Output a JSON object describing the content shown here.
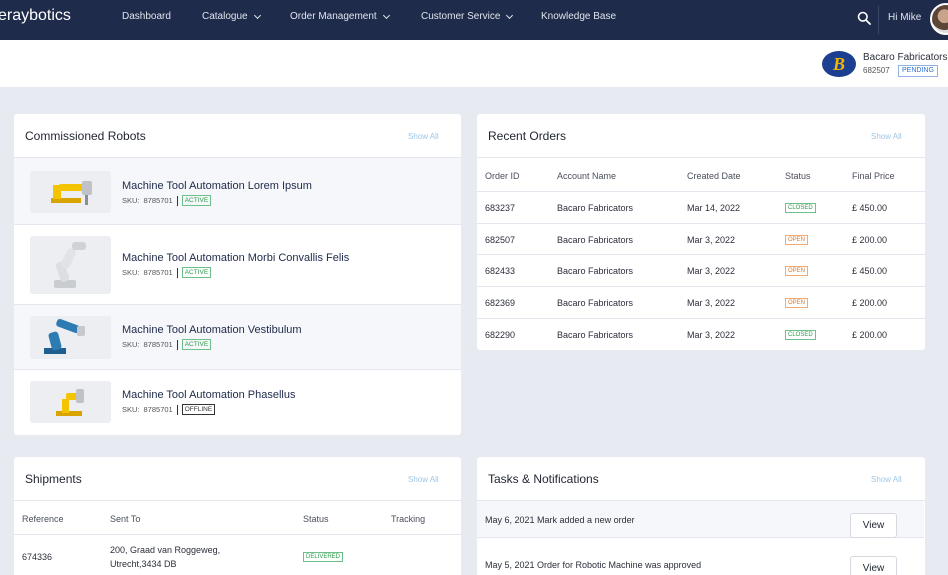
{
  "nav": {
    "brand": "eraybotics",
    "items": [
      {
        "label": "Dashboard"
      },
      {
        "label": "Catalogue"
      },
      {
        "label": "Order Management"
      },
      {
        "label": "Customer Service"
      },
      {
        "label": "Knowledge Base"
      }
    ],
    "greeting": "Hi Mike"
  },
  "company": {
    "logo_letter": "B",
    "name": "Bacaro Fabricators",
    "id": "682507",
    "status": "PENDING"
  },
  "robots": {
    "title": "Commissioned Robots",
    "show_all": "Show All",
    "items": [
      {
        "name": "Machine Tool Automation Lorem Ipsum",
        "sku_label": "SKU:",
        "sku": "8785701",
        "status": "ACTIVE"
      },
      {
        "name": "Machine Tool Automation Morbi Convallis Felis",
        "sku_label": "SKU:",
        "sku": "8785701",
        "status": "ACTIVE"
      },
      {
        "name": "Machine Tool Automation Vestibulum",
        "sku_label": "SKU:",
        "sku": "8785701",
        "status": "ACTIVE"
      },
      {
        "name": "Machine Tool Automation Phasellus",
        "sku_label": "SKU:",
        "sku": "8785701",
        "status": "OFFLINE"
      }
    ]
  },
  "orders": {
    "title": "Recent Orders",
    "show_all": "Show All",
    "columns": [
      "Order ID",
      "Account Name",
      "Created Date",
      "Status",
      "Final Price"
    ],
    "rows": [
      {
        "id": "683237",
        "account": "Bacaro Fabricators",
        "date": "Mar 14, 2022",
        "status": "CLOSED",
        "price": "£ 450.00"
      },
      {
        "id": "682507",
        "account": "Bacaro Fabricators",
        "date": "Mar 3, 2022",
        "status": "OPEN",
        "price": "£ 200.00"
      },
      {
        "id": "682433",
        "account": "Bacaro Fabricators",
        "date": "Mar 3, 2022",
        "status": "OPEN",
        "price": "£ 450.00"
      },
      {
        "id": "682369",
        "account": "Bacaro Fabricators",
        "date": "Mar 3, 2022",
        "status": "OPEN",
        "price": "£ 200.00"
      },
      {
        "id": "682290",
        "account": "Bacaro Fabricators",
        "date": "Mar 3, 2022",
        "status": "CLOSED",
        "price": "£ 200.00"
      }
    ]
  },
  "shipments": {
    "title": "Shipments",
    "show_all": "Show All",
    "columns": [
      "Reference",
      "Sent To",
      "Status",
      "Tracking"
    ],
    "rows": [
      {
        "reference": "674336",
        "address_line1": "200, Graad van Roggeweg,",
        "address_line2": "Utrecht,3434 DB",
        "status": "DELIVERED",
        "tracking": ""
      }
    ]
  },
  "tasks": {
    "title": "Tasks & Notifications",
    "show_all": "Show All",
    "items": [
      {
        "text": "May 6, 2021 Mark added a new order",
        "action": "View"
      },
      {
        "text": "May 5, 2021 Order for Robotic Machine was approved",
        "action": "View"
      }
    ]
  },
  "colors": {
    "nav_bg": "#1f2b4a",
    "page_bg": "#e7eaf1",
    "status_green": "#2e9b4a",
    "status_orange": "#e0782a",
    "pending_blue": "#2f6fd0",
    "logo_blue": "#1d3f8f",
    "logo_gold": "#f2b400"
  },
  "icons": {
    "search": "search-icon",
    "chevron": "chevron-down-icon",
    "avatar": "user-avatar"
  }
}
